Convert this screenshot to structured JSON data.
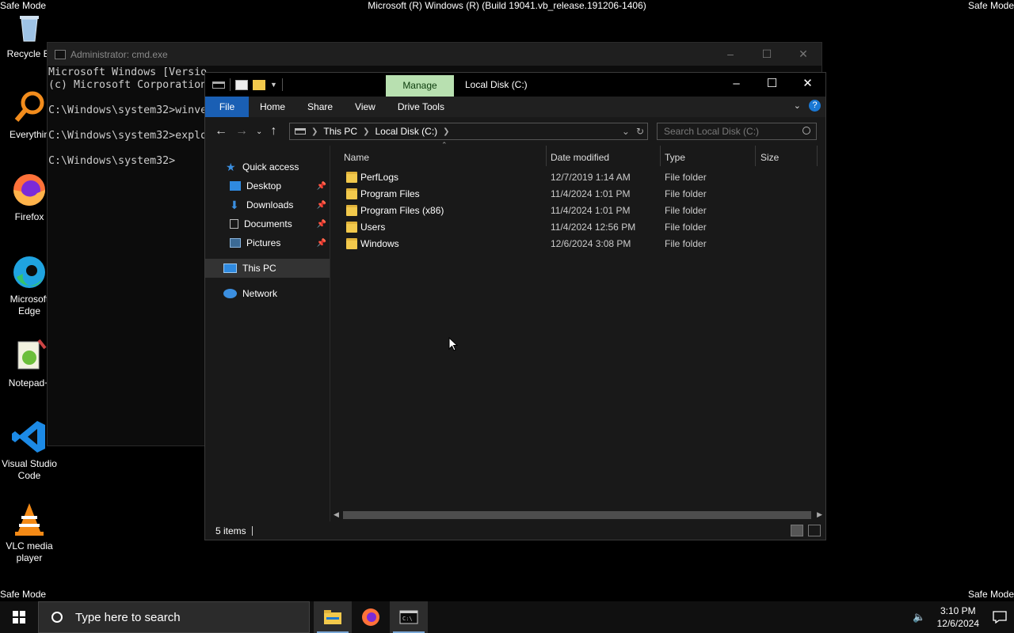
{
  "desktop": {
    "safe_mode_label": "Safe Mode",
    "build_text": "Microsoft (R) Windows (R) (Build 19041.vb_release.191206-1406)",
    "icons": [
      {
        "label": "Recycle Bi"
      },
      {
        "label": "Everythin"
      },
      {
        "label": "Firefox"
      },
      {
        "label": "Microsoft Edge"
      },
      {
        "label": "Notepad+"
      },
      {
        "label": "Visual Studio Code"
      },
      {
        "label": "VLC media player"
      }
    ]
  },
  "cmd": {
    "title": "Administrator: cmd.exe",
    "lines": [
      "Microsoft Windows [Versio",
      "(c) Microsoft Corporation",
      "",
      "C:\\Windows\\system32>winve",
      "",
      "C:\\Windows\\system32>explo",
      "",
      "C:\\Windows\\system32>"
    ]
  },
  "explorer": {
    "title": "Local Disk (C:)",
    "manage_tab": "Manage",
    "ribbon_tabs": [
      "File",
      "Home",
      "Share",
      "View",
      "Drive Tools"
    ],
    "help": "?",
    "breadcrumb": [
      "This PC",
      "Local Disk (C:)"
    ],
    "search_placeholder": "Search Local Disk (C:)",
    "nav": {
      "quick_access": "Quick access",
      "pinned": [
        "Desktop",
        "Downloads",
        "Documents",
        "Pictures"
      ],
      "this_pc": "This PC",
      "network": "Network"
    },
    "columns": [
      "Name",
      "Date modified",
      "Type",
      "Size"
    ],
    "files": [
      {
        "name": "PerfLogs",
        "date": "12/7/2019 1:14 AM",
        "type": "File folder"
      },
      {
        "name": "Program Files",
        "date": "11/4/2024 1:01 PM",
        "type": "File folder"
      },
      {
        "name": "Program Files (x86)",
        "date": "11/4/2024 1:01 PM",
        "type": "File folder"
      },
      {
        "name": "Users",
        "date": "11/4/2024 12:56 PM",
        "type": "File folder"
      },
      {
        "name": "Windows",
        "date": "12/6/2024 3:08 PM",
        "type": "File folder"
      }
    ],
    "status": "5 items"
  },
  "taskbar": {
    "search_placeholder": "Type here to search",
    "time": "3:10 PM",
    "date": "12/6/2024"
  },
  "colors": {
    "file_tab": "#1a5fb4",
    "manage_tab": "#b8e0b0",
    "folder": "#f2c94c"
  }
}
